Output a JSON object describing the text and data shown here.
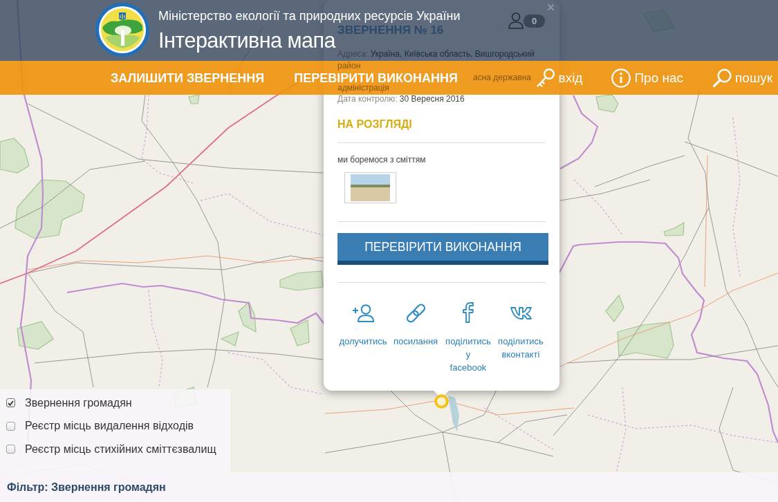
{
  "header": {
    "ministry": "Міністерство екології та природних ресурсів України",
    "title": "Інтерактивна мапа",
    "notification_count": "0"
  },
  "nav": {
    "links": [
      {
        "label": "ЗАЛИШИТИ ЗВЕРНЕННЯ"
      },
      {
        "label": "ПЕРЕВІРИТИ ВИКОНАННЯ"
      }
    ],
    "tools": [
      {
        "kind": "login",
        "label": "вхід"
      },
      {
        "kind": "about",
        "label": "Про нас"
      },
      {
        "kind": "search",
        "label": "пошук"
      }
    ]
  },
  "popup": {
    "title": "ЗВЕРНЕННЯ № 16",
    "address": {
      "label": "Адреса:",
      "value": "Україна, Київська область, Вишгородський район"
    },
    "note_lines": [
      "асна державна",
      "адміністрація"
    ],
    "control_date": {
      "label": "Дата контролю:",
      "value": "30 Вересня 2016"
    },
    "status": "НА РОЗГЛЯДІ",
    "description": "ми боремося з сміттям",
    "button": "ПЕРЕВІРИТИ ВИКОНАННЯ",
    "actions": [
      {
        "kind": "join",
        "label": "долучитись"
      },
      {
        "kind": "link",
        "label": "посилання"
      },
      {
        "kind": "facebook",
        "label": "поділитись у facebook"
      },
      {
        "kind": "vk",
        "label": "поділитись вконтакті"
      }
    ]
  },
  "layers": [
    {
      "label": "Звернення громадян",
      "checked": true
    },
    {
      "label": "Реєстр місць видалення відходів",
      "checked": false
    },
    {
      "label": "Реєстр місць стихійних сміттєзвалищ",
      "checked": false
    }
  ],
  "filter": "Фільтр: Звернення громадян"
}
